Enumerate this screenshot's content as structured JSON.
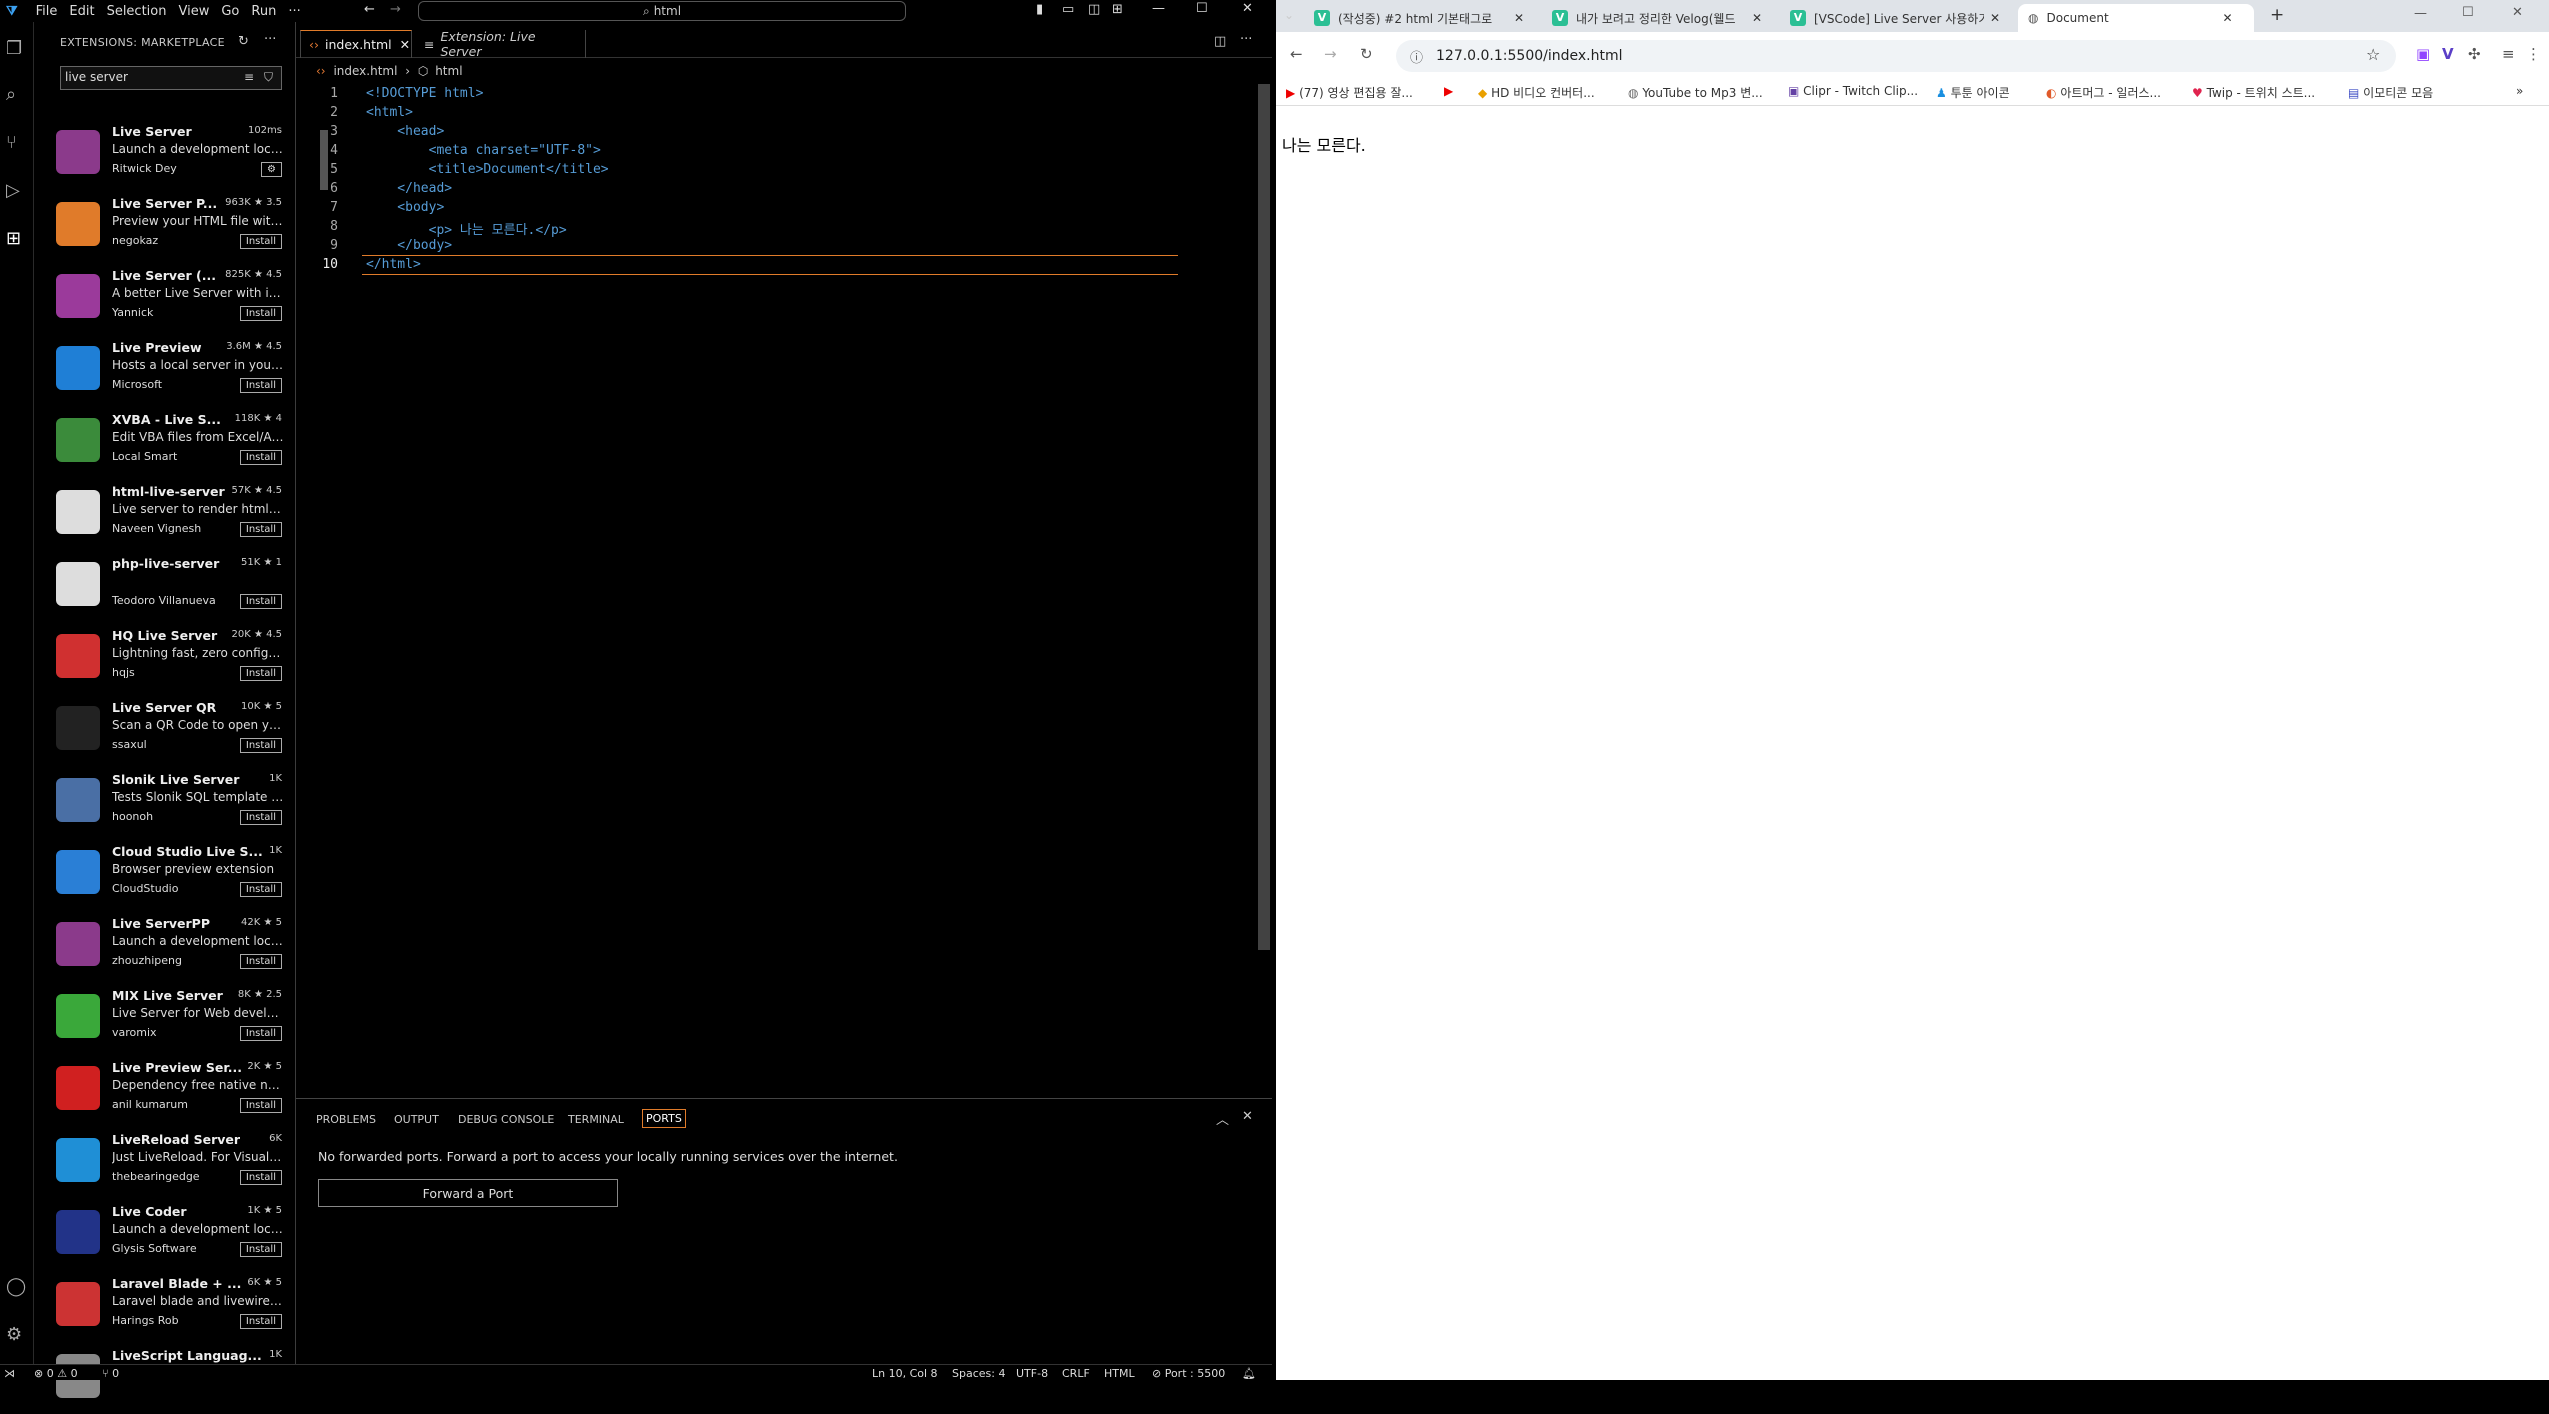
{
  "vscode": {
    "menu": [
      "File",
      "Edit",
      "Selection",
      "View",
      "Go",
      "Run",
      "···"
    ],
    "command_center": "html",
    "sidebar_title": "EXTENSIONS: MARKETPLACE",
    "search_value": "live server",
    "extensions": [
      {
        "name": "Live Server",
        "stats": "102ms",
        "desc": "Launch a development local...",
        "publisher": "Ritwick Dey",
        "button": "⚙",
        "color": "#8b3a8b"
      },
      {
        "name": "Live Server P...",
        "stats": "963K ★ 3.5",
        "desc": "Preview your HTML file with...",
        "publisher": "negokaz",
        "button": "Install",
        "color": "#e07b2a"
      },
      {
        "name": "Live Server (...",
        "stats": "825K ★ 4.5",
        "desc": "A better Live Server with ins...",
        "publisher": "Yannick",
        "button": "Install",
        "color": "#9b3a9b"
      },
      {
        "name": "Live Preview",
        "stats": "3.6M ★ 4.5",
        "desc": "Hosts a local server in your ...",
        "publisher": "Microsoft",
        "button": "Install",
        "color": "#1f7fd6"
      },
      {
        "name": "XVBA - Live S...",
        "stats": "118K ★ 4",
        "desc": "Edit VBA files from Excel/Ac...",
        "publisher": "Local Smart",
        "button": "Install",
        "color": "#3b8b3b"
      },
      {
        "name": "html-live-server",
        "stats": "57K ★ 4.5",
        "desc": "Live server to render html w...",
        "publisher": "Naveen Vignesh",
        "button": "Install",
        "color": "#dddddd"
      },
      {
        "name": "php-live-server",
        "stats": "51K ★ 1",
        "desc": "",
        "publisher": "Teodoro Villanueva",
        "button": "Install",
        "color": "#dddddd"
      },
      {
        "name": "HQ Live Server",
        "stats": "20K ★ 4.5",
        "desc": "Lightning fast, zero configur...",
        "publisher": "hqjs",
        "button": "Install",
        "color": "#d03030"
      },
      {
        "name": "Live Server QR",
        "stats": "10K ★ 5",
        "desc": "Scan a QR Code to open yo...",
        "publisher": "ssaxul",
        "button": "Install",
        "color": "#222222"
      },
      {
        "name": "Slonik Live Server",
        "stats": "1K",
        "desc": "Tests Slonik SQL template ta...",
        "publisher": "hoonoh",
        "button": "Install",
        "color": "#4a6fa5"
      },
      {
        "name": "Cloud Studio Live S...",
        "stats": "1K",
        "desc": "Browser preview extension",
        "publisher": "CloudStudio",
        "button": "Install",
        "color": "#2a7fd6"
      },
      {
        "name": "Live ServerPP",
        "stats": "42K ★ 5",
        "desc": "Launch a development local...",
        "publisher": "zhouzhipeng",
        "button": "Install",
        "color": "#8b3a8b"
      },
      {
        "name": "MIX Live Server",
        "stats": "8K ★ 2.5",
        "desc": "Live Server for Web develop...",
        "publisher": "varomix",
        "button": "Install",
        "color": "#3aa83a"
      },
      {
        "name": "Live Preview Ser...",
        "stats": "2K ★ 5",
        "desc": "Dependency free native nod...",
        "publisher": "anil kumarum",
        "button": "Install",
        "color": "#d02020"
      },
      {
        "name": "LiveReload Server",
        "stats": "6K",
        "desc": "Just LiveReload. For Visual S...",
        "publisher": "thebearingedge",
        "button": "Install",
        "color": "#1f8fd6"
      },
      {
        "name": "Live Coder",
        "stats": "1K ★ 5",
        "desc": "Launch a development local...",
        "publisher": "Glysis Software",
        "button": "Install",
        "color": "#223388"
      },
      {
        "name": "Laravel Blade + ...",
        "stats": "6K ★ 5",
        "desc": "Laravel blade and livewire la...",
        "publisher": "Harings Rob",
        "button": "Install",
        "color": "#cc3333"
      },
      {
        "name": "LiveScript Languag...",
        "stats": "1K",
        "desc": "",
        "publisher": "",
        "button": "",
        "color": "#888888"
      }
    ],
    "tabs": [
      {
        "label": "index.html"
      },
      {
        "label": "Extension: Live Server"
      }
    ],
    "breadcrumb": [
      "index.html",
      "html"
    ],
    "code_lines": [
      {
        "n": "1",
        "t": "<!DOCTYPE html>"
      },
      {
        "n": "2",
        "t": "<html>"
      },
      {
        "n": "3",
        "t": "    <head>"
      },
      {
        "n": "4",
        "t": "        <meta charset=\"UTF-8\">"
      },
      {
        "n": "5",
        "t": "        <title>Document</title>"
      },
      {
        "n": "6",
        "t": "    </head>"
      },
      {
        "n": "7",
        "t": "    <body>"
      },
      {
        "n": "8",
        "t": "        <p> 나는 모른다.</p>"
      },
      {
        "n": "9",
        "t": "    </body>"
      },
      {
        "n": "10",
        "t": "</html>"
      }
    ],
    "panel_tabs": [
      "PROBLEMS",
      "OUTPUT",
      "DEBUG CONSOLE",
      "TERMINAL",
      "PORTS"
    ],
    "ports_message": "No forwarded ports. Forward a port to access your locally running services over the internet.",
    "forward_button": "Forward a Port",
    "status": {
      "errors": "⊗ 0 ⚠ 0",
      "ports": "⑂ 0",
      "position": "Ln 10, Col 8",
      "spaces": "Spaces: 4",
      "encoding": "UTF-8",
      "eol": "CRLF",
      "language": "HTML",
      "live": "⊘ Port : 5500"
    }
  },
  "browser": {
    "tabs": [
      {
        "label": "(작성중) #2 html 기본태그로",
        "fav": "V"
      },
      {
        "label": "내가 보려고 정리한 Velog(웰드",
        "fav": "V"
      },
      {
        "label": "[VSCode] Live Server 사용하기",
        "fav": "V"
      },
      {
        "label": "Document",
        "fav": ""
      }
    ],
    "url": "127.0.0.1:5500/index.html",
    "bookmarks": [
      "(77) 영상 편집용 잘...",
      "",
      "HD 비디오 컨버터...",
      "YouTube to Mp3 변...",
      "Clipr - Twitch Clip...",
      "투툰 아이콘",
      "아트머그 - 일러스...",
      "Twip - 트위치 스트...",
      "이모티콘 모음"
    ],
    "page_text": "나는 모른다."
  }
}
